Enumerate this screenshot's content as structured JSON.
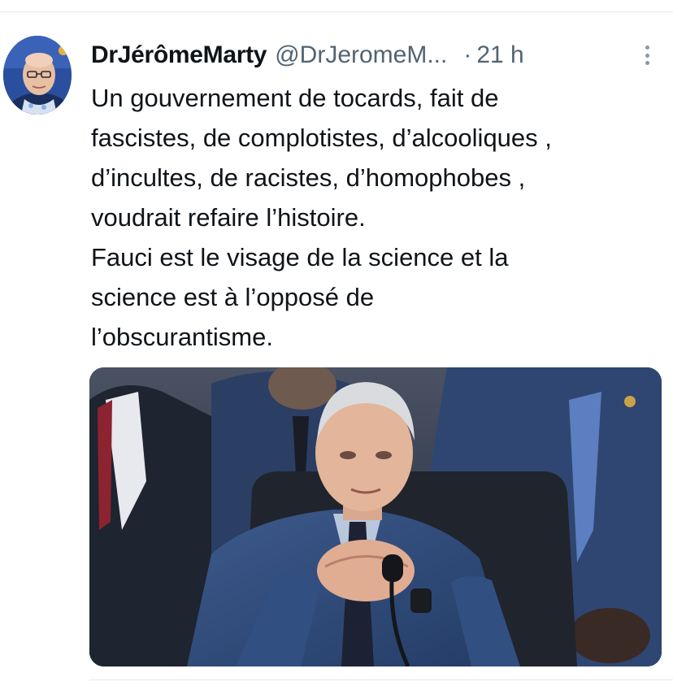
{
  "tweet": {
    "author": {
      "display_name": "DrJérômeMarty",
      "handle": "@DrJeromeM...",
      "avatar_icon": "profile-photo"
    },
    "separator": "·",
    "timestamp": "21 h",
    "more_icon": "vertical-ellipsis-icon",
    "text_lines": [
      "Un gouvernement de tocards, fait de",
      "fascistes, de complotistes, d’alcooliques ,",
      "d’incultes, de racistes, d’homophobes ,",
      "voudrait refaire l’histoire.",
      "Fauci est le visage de la science et la",
      "science est à l’opposé de",
      "l’obscurantisme."
    ],
    "media": {
      "type": "photo"
    }
  },
  "colors": {
    "text_primary": "#0f1419",
    "text_secondary": "#536471",
    "divider": "#e6e8ea"
  }
}
